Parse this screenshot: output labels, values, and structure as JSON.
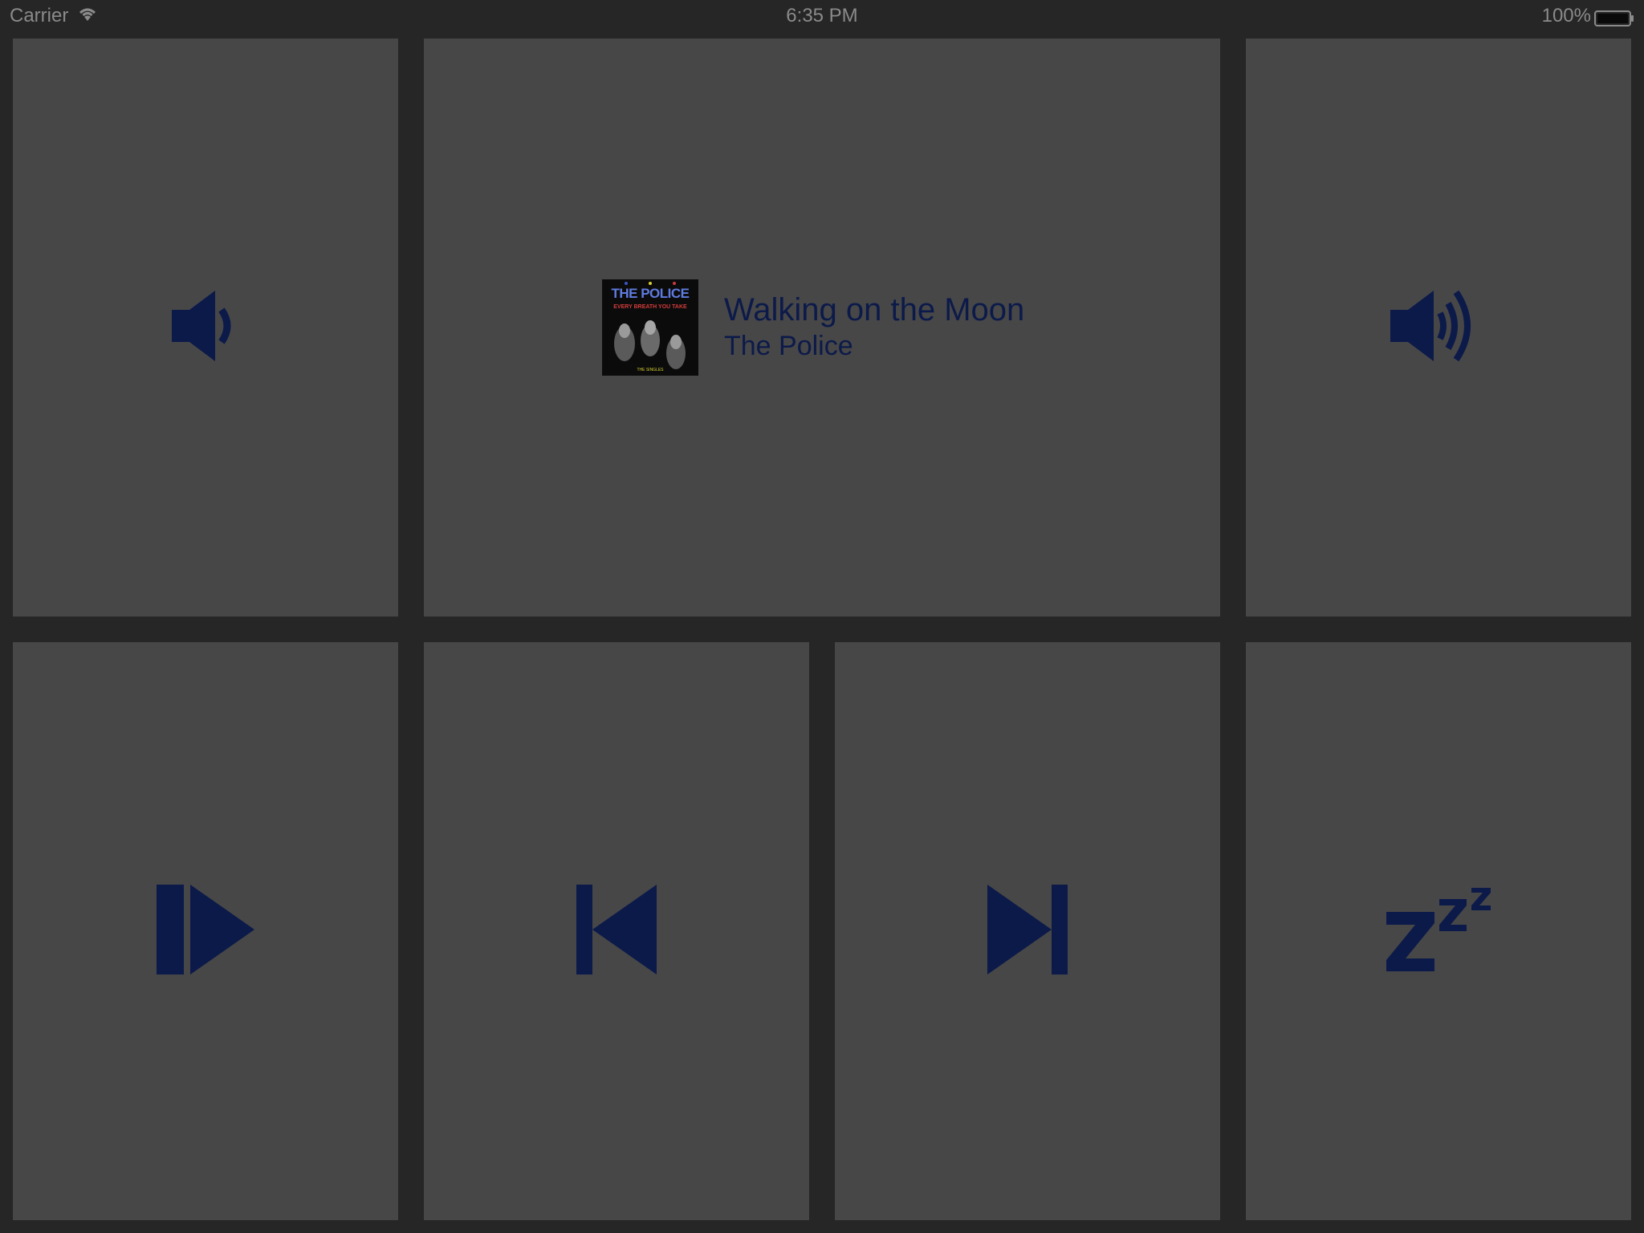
{
  "status_bar": {
    "carrier": "Carrier",
    "time": "6:35 PM",
    "battery_percent": "100%"
  },
  "now_playing": {
    "title": "Walking on the Moon",
    "artist": "The Police",
    "album_art": {
      "band": "THE POLICE",
      "album": "EVERY BREATH YOU TAKE",
      "edition": "THE SINGLES"
    }
  },
  "controls": {
    "volume_down": "speaker-low-icon",
    "volume_up": "speaker-high-icon",
    "play_pause": "play-pause-icon",
    "previous": "skip-previous-icon",
    "next": "skip-next-icon",
    "sleep": "sleep-zzz-icon"
  },
  "colors": {
    "background": "#262626",
    "tile": "#474747",
    "accent": "#0c1a4a",
    "status_text": "#8a8a8a"
  }
}
